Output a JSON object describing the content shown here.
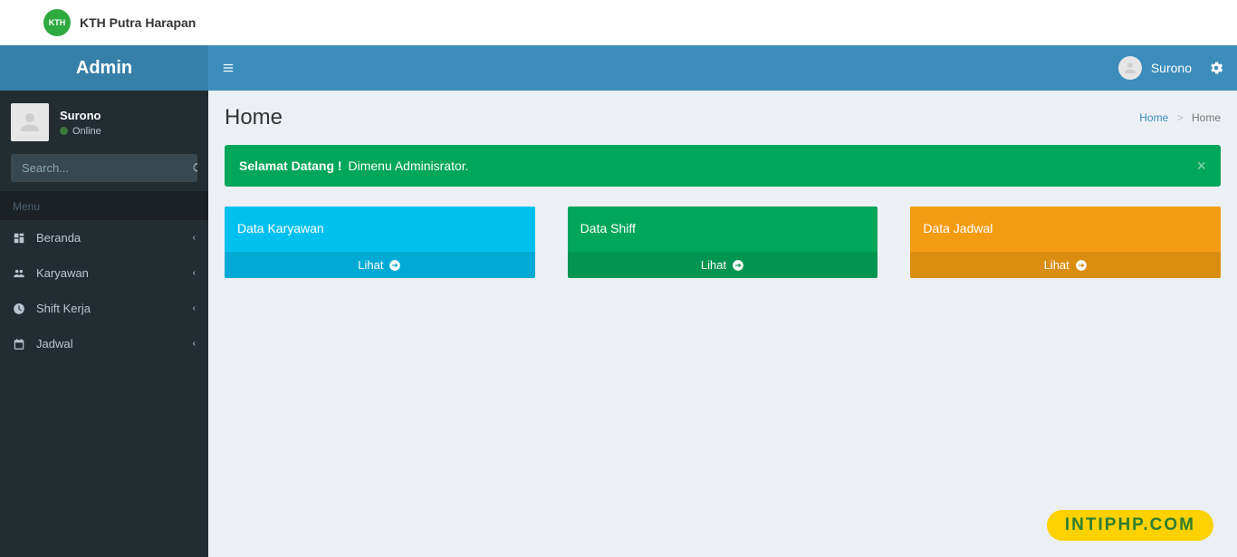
{
  "brand": {
    "name": "KTH Putra Harapan",
    "logo_text": "KTH"
  },
  "sidebar": {
    "title": "Admin",
    "user": {
      "name": "Surono",
      "status": "Online"
    },
    "search_placeholder": "Search...",
    "menu_header": "Menu",
    "items": [
      {
        "label": "Beranda",
        "icon": "grid-icon"
      },
      {
        "label": "Karyawan",
        "icon": "users-icon"
      },
      {
        "label": "Shift Kerja",
        "icon": "clock-icon"
      },
      {
        "label": "Jadwal",
        "icon": "calendar-icon"
      }
    ]
  },
  "topbar": {
    "username": "Surono"
  },
  "page": {
    "title": "Home",
    "breadcrumb": {
      "root": "Home",
      "current": "Home"
    },
    "alert": {
      "strong": "Selamat Datang !",
      "text": " Dimenu Adminisrator."
    },
    "cards": [
      {
        "title": "Data Karyawan",
        "link": "Lihat"
      },
      {
        "title": "Data Shiff",
        "link": "Lihat"
      },
      {
        "title": "Data Jadwal",
        "link": "Lihat"
      }
    ]
  },
  "watermark": "INTIPHP.COM"
}
